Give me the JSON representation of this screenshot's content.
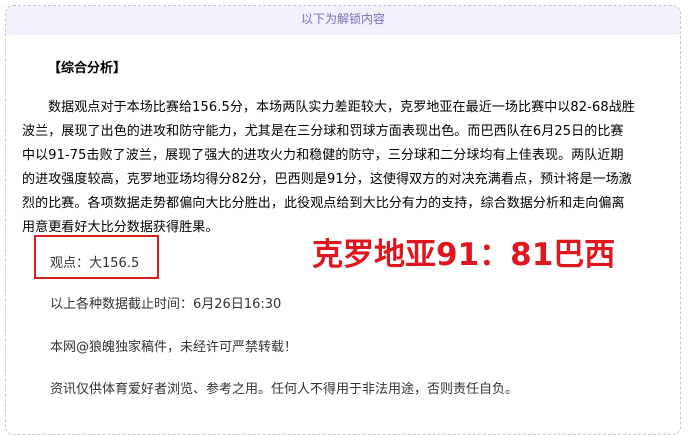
{
  "banner": {
    "text": "以下为解锁内容"
  },
  "analysis": {
    "heading": "【综合分析】",
    "lines": [
      "数据观点对于本场比赛给156.5分，本场两队实力差距较大，克罗地亚在最近一场比赛中以82-68战胜",
      "波兰，展现了出色的进攻和防守能力，尤其是在三分球和罚球方面表现出色。而巴西队在6月25日的比赛",
      "中以91-75击败了波兰，展现了强大的进攻火力和稳健的防守，三分球和二分球均有上佳表现。两队近期",
      "的进攻强度较高，克罗地亚场均得分82分，巴西则是91分，这使得双方的对决充满看点，预计将是一场激",
      "烈的比赛。各项数据走势都偏向大比分胜出，此役观点给到大比分有力的支持，综合数据分析和走向偏离",
      "用意更看好大比分数据获得胜果。"
    ]
  },
  "viewpoint": {
    "text": "观点：大156.5"
  },
  "score": {
    "text": "克罗地亚91：81巴西"
  },
  "cutoff": {
    "text": "以上各种数据截止时间：6月26日16:30"
  },
  "copyright": {
    "text": "本网@狼魄独家稿件，未经许可严禁转载！"
  },
  "disclaimer": {
    "text": "资讯仅供体育爱好者浏览、参考之用。任何人不得用于非法用途，否则责任自负。"
  }
}
